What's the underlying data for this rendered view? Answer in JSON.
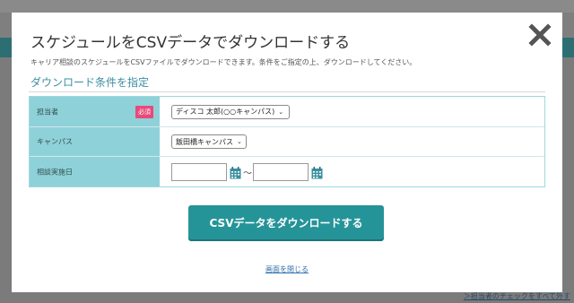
{
  "background": {
    "check_all_link": "＞担当者のチェックをすべて外す"
  },
  "modal": {
    "title": "スケジュールをCSVデータでダウンロードする",
    "description": "キャリア相談のスケジュールをCSVファイルでダウンロードできます。条件をご指定の上、ダウンロードしてください。",
    "section_title": "ダウンロード条件を指定",
    "close_icon": "close-x-icon",
    "rows": {
      "staff": {
        "label": "担当者",
        "required_badge": "必須",
        "selected": "ディスコ 太郎(○○キャンパス)"
      },
      "campus": {
        "label": "キャンパス",
        "selected": "飯田橋キャンパス"
      },
      "date": {
        "label": "相談実施日",
        "from_value": "",
        "to_value": "",
        "separator": "〜"
      }
    },
    "download_button": "CSVデータをダウンロードする",
    "close_link": "画面を閉じる"
  },
  "colors": {
    "accent": "#259498",
    "label_bg": "#8fd1d8",
    "required": "#e8497a",
    "link": "#2f6fa8"
  }
}
